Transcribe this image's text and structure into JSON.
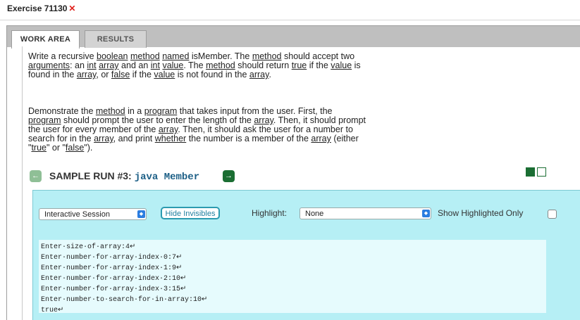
{
  "window": {
    "title": "Exercise 71130",
    "close_glyph": "✕"
  },
  "tabs": [
    {
      "label": "WORK AREA",
      "active": true
    },
    {
      "label": "RESULTS",
      "active": false
    }
  ],
  "description": {
    "paragraph1_segments": [
      {
        "t": "Write a recursive ",
        "u": false
      },
      {
        "t": "boolean",
        "u": true
      },
      {
        "t": " ",
        "u": false
      },
      {
        "t": "method",
        "u": true
      },
      {
        "t": " ",
        "u": false
      },
      {
        "t": "named",
        "u": true
      },
      {
        "t": " isMember. The ",
        "u": false
      },
      {
        "t": "method",
        "u": true
      },
      {
        "t": " should accept two ",
        "u": false
      },
      {
        "t": "arguments",
        "u": true
      },
      {
        "t": ": an ",
        "u": false
      },
      {
        "t": "int",
        "u": true
      },
      {
        "t": " ",
        "u": false
      },
      {
        "t": "array",
        "u": true
      },
      {
        "t": " and an ",
        "u": false
      },
      {
        "t": "int",
        "u": true
      },
      {
        "t": " ",
        "u": false
      },
      {
        "t": "value",
        "u": true
      },
      {
        "t": ". The ",
        "u": false
      },
      {
        "t": "method",
        "u": true
      },
      {
        "t": " should return ",
        "u": false
      },
      {
        "t": "true",
        "u": true
      },
      {
        "t": " if the ",
        "u": false
      },
      {
        "t": "value",
        "u": true
      },
      {
        "t": " is found in the ",
        "u": false
      },
      {
        "t": "array",
        "u": true
      },
      {
        "t": ", or ",
        "u": false
      },
      {
        "t": "false",
        "u": true
      },
      {
        "t": " if the ",
        "u": false
      },
      {
        "t": "value",
        "u": true
      },
      {
        "t": " is not found in the ",
        "u": false
      },
      {
        "t": "array",
        "u": true
      },
      {
        "t": ".",
        "u": false
      }
    ],
    "paragraph2_segments": [
      {
        "t": "Demonstrate the ",
        "u": false
      },
      {
        "t": "method",
        "u": true
      },
      {
        "t": " in a ",
        "u": false
      },
      {
        "t": "program",
        "u": true
      },
      {
        "t": " that takes input from the user. First, the ",
        "u": false
      },
      {
        "t": "program",
        "u": true
      },
      {
        "t": " should prompt the user to enter the length of the ",
        "u": false
      },
      {
        "t": "array",
        "u": true
      },
      {
        "t": ". Then, it should prompt the user for every member of the ",
        "u": false
      },
      {
        "t": "array",
        "u": true
      },
      {
        "t": ". Then, it should ask the user for a number to search for in the ",
        "u": false
      },
      {
        "t": "array",
        "u": true
      },
      {
        "t": ", and print ",
        "u": false
      },
      {
        "t": "whether",
        "u": true
      },
      {
        "t": " the number is a member of the ",
        "u": false
      },
      {
        "t": "array",
        "u": true
      },
      {
        "t": " (either \"",
        "u": false
      },
      {
        "t": "true",
        "u": true
      },
      {
        "t": "\" or \"",
        "u": false
      },
      {
        "t": "false",
        "u": true
      },
      {
        "t": "\").",
        "u": false
      }
    ]
  },
  "sample_run": {
    "label": "SAMPLE RUN #3:",
    "command": "java Member",
    "prev_glyph": "←",
    "next_glyph": "→"
  },
  "session": {
    "mode_select": "Interactive Session",
    "hide_invisibles_label": "Hide Invisibles",
    "highlight_label": "Highlight:",
    "highlight_value": "None",
    "show_highlighted_label": "Show Highlighted Only",
    "select_arrow_glyph": "◆",
    "console_lines": [
      "Enter·size·of·array:4↵",
      "Enter·number·for·array·index·0:7↵",
      "Enter·number·for·array·index·1:9↵",
      "Enter·number·for·array·index·2:10↵",
      "Enter·number·for·array·index·3:15↵",
      "Enter·number·to·search·for·in·array:10↵",
      "true↵"
    ]
  },
  "colors": {
    "close": "#e0201b",
    "accent_green": "#1b6e33",
    "session_bg": "#b6eff5"
  }
}
